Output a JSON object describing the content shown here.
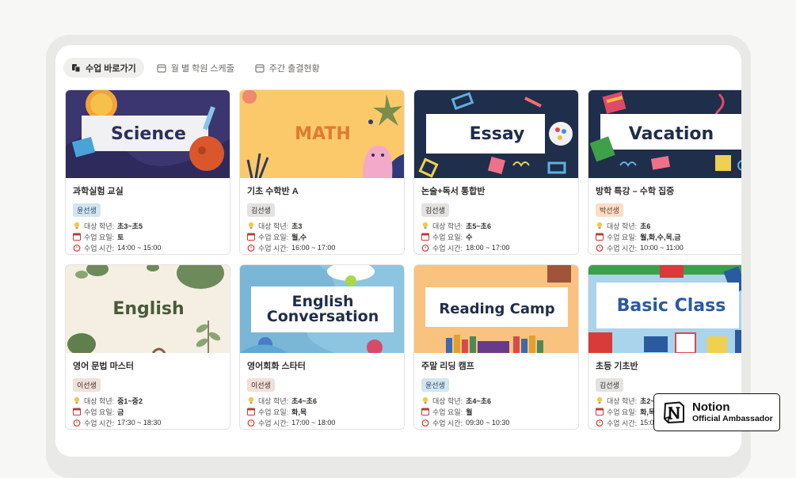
{
  "tabs": [
    {
      "label": "수업 바로가기",
      "icon": "document-stack-icon",
      "active": true
    },
    {
      "label": "월 별 학원 스케줄",
      "icon": "calendar-icon",
      "active": false
    },
    {
      "label": "주간 출결현황",
      "icon": "calendar-icon",
      "active": false
    }
  ],
  "labels": {
    "grade": "대상 학년:",
    "days": "수업 요일:",
    "time": "수업 시간:"
  },
  "classes": [
    {
      "cover": "Science",
      "name": "과학실험 교실",
      "teacher": "윤선생",
      "badge_color": "#d3e5ef",
      "badge_text_color": "#28456c",
      "grade": "초3~초5",
      "days": "토",
      "time": "14:00 ~ 15:00"
    },
    {
      "cover": "MATH",
      "name": "기초 수학반 A",
      "teacher": "김선생",
      "badge_color": "#e3e2e0",
      "badge_text_color": "#32302c",
      "grade": "초3",
      "days": "월,수",
      "time": "16:00 ~ 17:00"
    },
    {
      "cover": "Essay",
      "name": "논술+독서 통합반",
      "teacher": "김선생",
      "badge_color": "#e3e2e0",
      "badge_text_color": "#32302c",
      "grade": "초5~초6",
      "days": "수",
      "time": "18:00 ~ 17:00"
    },
    {
      "cover": "Vacation",
      "name": "방학 특강 – 수학 집중",
      "teacher": "박선생",
      "badge_color": "#fadec9",
      "badge_text_color": "#5c3b23",
      "grade": "초6",
      "days": "월,화,수,목,금",
      "time": "10:00 ~ 11:00"
    },
    {
      "cover": "English",
      "name": "영어 문법 마스터",
      "teacher": "이선생",
      "badge_color": "#eee0da",
      "badge_text_color": "#442a1e",
      "grade": "중1~중2",
      "days": "금",
      "time": "17:30 ~ 18:30"
    },
    {
      "cover": "English Conversation",
      "name": "영어회화 스타터",
      "teacher": "이선생",
      "badge_color": "#eee0da",
      "badge_text_color": "#442a1e",
      "grade": "초4~초6",
      "days": "화,목",
      "time": "17:00 ~ 18:00"
    },
    {
      "cover": "Reading Camp",
      "name": "주말 리딩 캠프",
      "teacher": "윤선생",
      "badge_color": "#d3e5ef",
      "badge_text_color": "#28456c",
      "grade": "초4~초6",
      "days": "월",
      "time": "09:30 ~ 10:30"
    },
    {
      "cover": "Basic Class",
      "name": "초등 기초반",
      "teacher": "김선생",
      "badge_color": "#e3e2e0",
      "badge_text_color": "#32302c",
      "grade": "초2~",
      "days": "화,목",
      "time": "15:00"
    }
  ],
  "notion_badge": {
    "title": "Notion",
    "subtitle": "Official Ambassador"
  }
}
